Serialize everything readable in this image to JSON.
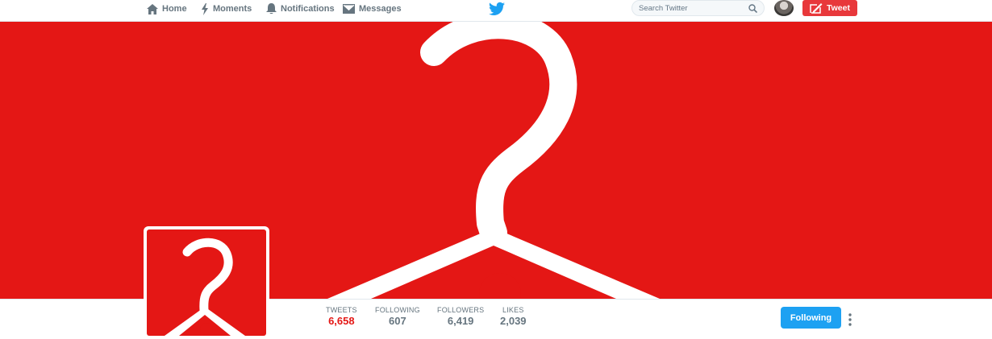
{
  "nav": {
    "home": "Home",
    "moments": "Moments",
    "notifications": "Notifications",
    "messages": "Messages"
  },
  "search": {
    "placeholder": "Search Twitter"
  },
  "tweet_button": "Tweet",
  "colors": {
    "accent": "#e41715",
    "follow_blue": "#1da1f2",
    "text_gray": "#66757f"
  },
  "icons": [
    "home-icon",
    "moments-icon",
    "notifications-icon",
    "messages-icon",
    "twitter-bird-icon",
    "search-icon",
    "compose-icon",
    "more-icon"
  ],
  "stats": [
    {
      "label": "TWEETS",
      "value": "6,658"
    },
    {
      "label": "FOLLOWING",
      "value": "607"
    },
    {
      "label": "FOLLOWERS",
      "value": "6,419"
    },
    {
      "label": "LIKES",
      "value": "2,039"
    }
  ],
  "follow_button": "Following"
}
